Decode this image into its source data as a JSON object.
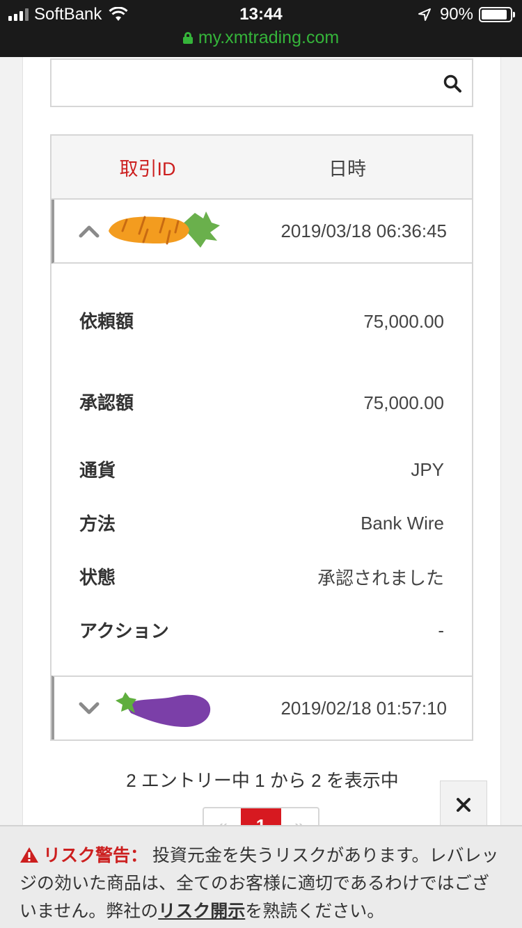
{
  "status_bar": {
    "carrier": "SoftBank",
    "time": "13:44",
    "battery": "90%",
    "url": "my.xmtrading.com"
  },
  "search": {
    "value": "",
    "placeholder": ""
  },
  "table": {
    "headers": {
      "id": "取引ID",
      "date": "日時"
    },
    "rows": [
      {
        "date": "2019/03/18 06:36:45",
        "expanded": true,
        "icon": "carrier-redaction-icon",
        "details": [
          {
            "label": "依頼額",
            "value": "75,000.00"
          },
          {
            "label": "承認額",
            "value": "75,000.00"
          },
          {
            "label": "通貨",
            "value": "JPY"
          },
          {
            "label": "方法",
            "value": "Bank Wire"
          },
          {
            "label": "状態",
            "value": "承認されました"
          },
          {
            "label": "アクション",
            "value": "-"
          }
        ]
      },
      {
        "date": "2019/02/18 01:57:10",
        "expanded": false,
        "icon": "eggplant-redaction-icon"
      }
    ]
  },
  "entries_text": "2 エントリー中 1 から 2 を表示中",
  "pagination": {
    "prev": "«",
    "current": "1",
    "next": "»"
  },
  "risk_banner": {
    "title": "リスク警告：",
    "text": " 投資元金を失うリスクがあります。レバレッジの効いた商品は、全てのお客様に適切であるわけではございません。弊社の",
    "link": "リスク開示",
    "text_end": "を熟読ください。"
  },
  "colors": {
    "accent": "#d71920",
    "url_green": "#35b43a",
    "header_red": "#cc1f1f"
  }
}
